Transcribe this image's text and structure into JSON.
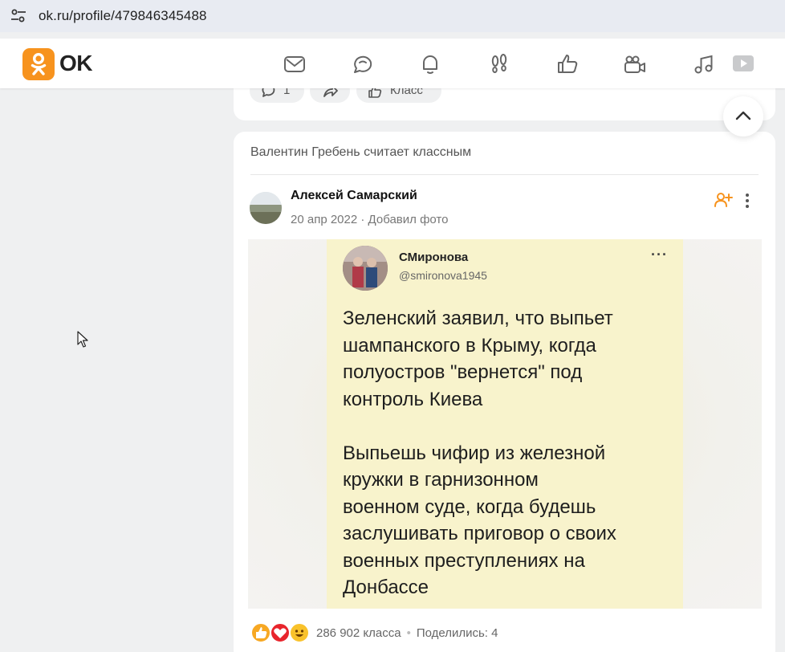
{
  "browser": {
    "url": "ok.ru/profile/479846345488",
    "site_controls_icon": "tune-icon"
  },
  "header": {
    "logo_text": "OK",
    "brand_color": "#f7931e",
    "nav_icons": [
      "mail-icon",
      "chat-icon",
      "bell-icon",
      "guests-footprints-icon",
      "like-icon",
      "video-camera-icon",
      "music-icon",
      "video-play-icon"
    ]
  },
  "prev_post": {
    "comment_count": "1",
    "class_label": "Класс"
  },
  "post": {
    "context": "Валентин Гребень считает классным",
    "author": "Алексей Самарский",
    "date": "20 апр 2022",
    "action": "Добавил фото",
    "meta_separator": "·",
    "image": {
      "account_name": "СМиронова",
      "account_handle": "@smironova1945",
      "menu": "···",
      "text": "Зеленский заявил, что выпьет\nшампанского в Крыму, когда\nполуостров \"вернется\" под\nконтроль Киева\n\nВыпьешь  чифир из железной\nкружки в гарнизонном\nвоенном суде, когда будешь\nзаслушивать приговор о своих\nвоенных преступлениях на\nДонбассе"
    },
    "footer": {
      "reaction_icons": [
        "like-reaction-icon",
        "heart-reaction-icon",
        "laugh-reaction-icon"
      ],
      "likes": "286 902 класса",
      "shares": "Поделились: 4"
    }
  }
}
